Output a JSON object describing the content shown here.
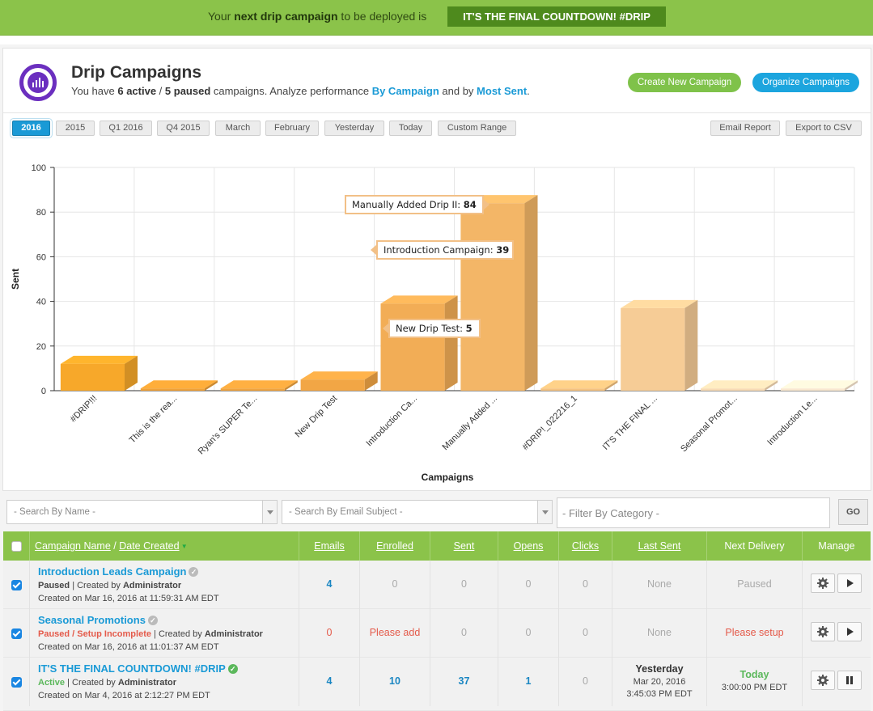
{
  "banner": {
    "prefix": "Your ",
    "bold": "next drip campaign",
    "suffix": " to be deployed is",
    "cta": "IT'S THE FINAL COUNTDOWN! #DRIP"
  },
  "header": {
    "title": "Drip Campaigns",
    "sub_prefix": "You have ",
    "active": "6 active",
    "sep": " / ",
    "paused": "5 paused",
    "sub_mid": " campaigns. Analyze performance ",
    "link1": "By Campaign",
    "sub_and": " and by ",
    "link2": "Most Sent",
    "sub_end": ".",
    "create_button": "Create New Campaign",
    "organize_button": "Organize Campaigns"
  },
  "ranges": [
    "2016",
    "2015",
    "Q1 2016",
    "Q4 2015",
    "March",
    "February",
    "Yesterday",
    "Today",
    "Custom Range"
  ],
  "active_range": "2016",
  "actions": {
    "email_report": "Email Report",
    "export_csv": "Export to CSV"
  },
  "chart_data": {
    "type": "bar",
    "xlabel": "Campaigns",
    "ylabel": "Sent",
    "ylim": [
      0,
      100
    ],
    "yticks": [
      0,
      20,
      40,
      60,
      80,
      100
    ],
    "categories": [
      "#DRIP!!!",
      "This is the rea...",
      "Ryan's SUPER Te...",
      "New Drip Test",
      "Introduction Ca...",
      "Manually Added ...",
      "#DRIP!_022216_1",
      "IT'S THE FINAL ...",
      "Seasonal Promot...",
      "Introduction Le..."
    ],
    "values": [
      12,
      1,
      1,
      5,
      39,
      84,
      1,
      37,
      1,
      1
    ],
    "colors": [
      "#f7a82a",
      "#f0a136",
      "#f0a33d",
      "#f2a645",
      "#f2ad56",
      "#f3b667",
      "#f5c27f",
      "#f6cc96",
      "#f8dbb4",
      "#fae8d0"
    ],
    "tooltips": [
      {
        "label": "Manually Added Drip II: ",
        "value": "84"
      },
      {
        "label": "Introduction Campaign: ",
        "value": "39"
      },
      {
        "label": "New Drip Test: ",
        "value": "5"
      }
    ],
    "grid": true
  },
  "filters": {
    "name_placeholder": "- Search By Name -",
    "subject_placeholder": "- Search By Email Subject -",
    "category_placeholder": "- Filter By Category -",
    "go": "GO"
  },
  "table": {
    "headers": {
      "campaign": "Campaign Name",
      "slash": " / ",
      "date": "Date Created",
      "emails": "Emails",
      "enrolled": "Enrolled",
      "sent": "Sent",
      "opens": "Opens",
      "clicks": "Clicks",
      "last_sent": "Last Sent",
      "next_delivery": "Next Delivery",
      "manage": "Manage"
    },
    "rows": [
      {
        "name": "Introduction Leads Campaign",
        "status": "Paused",
        "created_by": " | Created by ",
        "author": "Administrator",
        "date": "Created on Mar 16, 2016 at 11:59:31 AM EDT",
        "emails": "4",
        "enrolled": "0",
        "sent": "0",
        "opens": "0",
        "clicks": "0",
        "last_sent": "None",
        "next": "Paused"
      },
      {
        "name": "Seasonal Promotions",
        "status": "Paused / Setup Incomplete",
        "created_by": " | Created by ",
        "author": "Administrator",
        "date": "Created on Mar 16, 2016 at 11:01:37 AM EDT",
        "emails": "0",
        "enrolled": "Please add",
        "sent": "0",
        "opens": "0",
        "clicks": "0",
        "last_sent": "None",
        "next": "Please setup"
      },
      {
        "name": "IT'S THE FINAL COUNTDOWN! #DRIP",
        "status": "Active",
        "created_by": " | Created by ",
        "author": "Administrator",
        "date": "Created on Mar 4, 2016 at 2:12:27 PM EDT",
        "emails": "4",
        "enrolled": "10",
        "sent": "37",
        "opens": "1",
        "clicks": "0",
        "last_sent_day": "Yesterday",
        "last_sent_date": "Mar 20, 2016",
        "last_sent_time": "3:45:03 PM EDT",
        "next_day": "Today",
        "next_time": "3:00:00 PM EDT"
      }
    ]
  }
}
